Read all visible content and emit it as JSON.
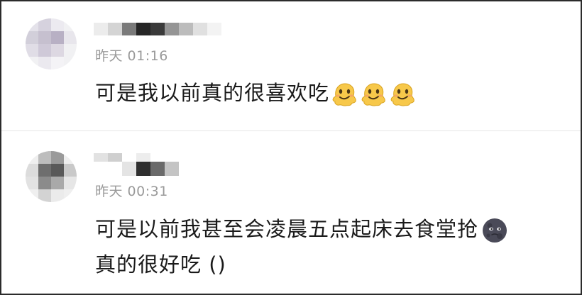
{
  "comments": [
    {
      "time": "昨天 01:16",
      "text": "可是我以前真的很喜欢吃",
      "emojis": [
        "melting-face",
        "melting-face",
        "melting-face"
      ]
    },
    {
      "time": "昨天 00:31",
      "text_line1": "可是以前我甚至会凌晨五点起床去食堂抢",
      "emoji": "new-moon-face",
      "text_line2": "真的很好吃 ()"
    }
  ],
  "colors": {
    "text": "#1a1a1a",
    "time": "#9a9a9a",
    "divider": "#e6e6e6",
    "border": "#2b2b2b"
  }
}
